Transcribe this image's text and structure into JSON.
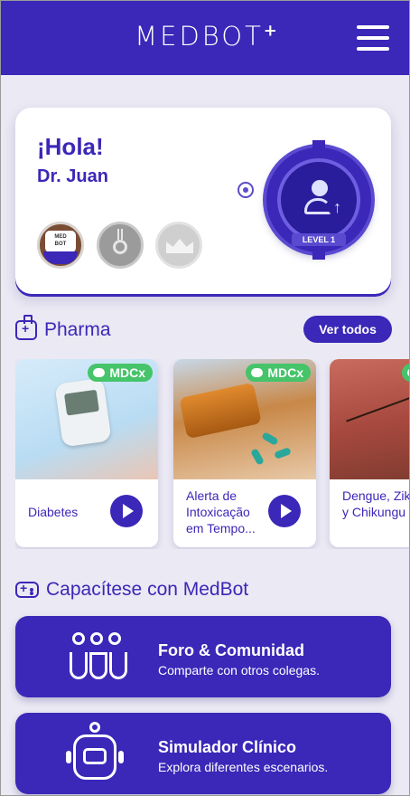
{
  "header": {
    "brand": "MEDBOT",
    "brand_sup": "+",
    "menu_icon": "hamburger-menu-icon"
  },
  "greeting": {
    "hello": "¡Hola!",
    "name": "Dr. Juan",
    "level_label": "LEVEL 1",
    "badges": [
      "medbot-chef-badge-icon",
      "silver-medal-badge-icon",
      "crown-badge-icon"
    ]
  },
  "pharma": {
    "heading": "Pharma",
    "see_all": "Ver todos",
    "tag": "MDCx",
    "cards": [
      {
        "title": "Diabetes"
      },
      {
        "title": "Alerta de Intoxicação em Tempo..."
      },
      {
        "title": "Dengue, Zika y Chikungu"
      }
    ]
  },
  "training": {
    "heading": "Capacítese con MedBot",
    "actions": [
      {
        "title": "Foro & Comunidad",
        "subtitle": "Comparte con otros colegas."
      },
      {
        "title": "Simulador Clínico",
        "subtitle": "Explora diferentes escenarios."
      }
    ]
  },
  "colors": {
    "primary": "#3b27b8",
    "accent_green": "#45c46a",
    "background": "#ebe9f3"
  }
}
